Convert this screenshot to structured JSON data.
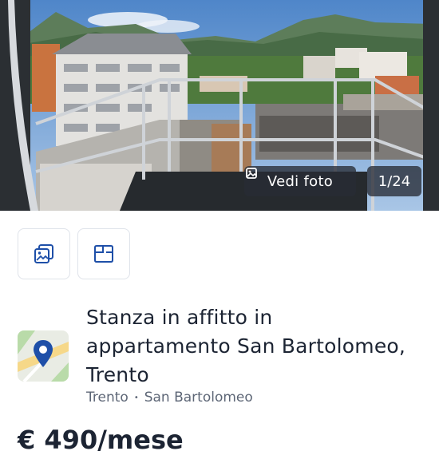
{
  "photo": {
    "view_label": "Vedi foto",
    "counter": "1/24"
  },
  "actions": {
    "gallery_icon": "image-gallery-icon",
    "plan_icon": "floor-plan-icon"
  },
  "listing": {
    "title": "Stanza in affitto in appartamento San Bartolomeo, Trento",
    "city": "Trento",
    "separator": "•",
    "district": "San Bartolomeo",
    "price_partial": "€ 490/mese"
  },
  "colors": {
    "text_primary": "#1c2433",
    "text_secondary": "#5d6676",
    "tile_border": "#dfe3ea",
    "pin": "#1e4fa8"
  }
}
